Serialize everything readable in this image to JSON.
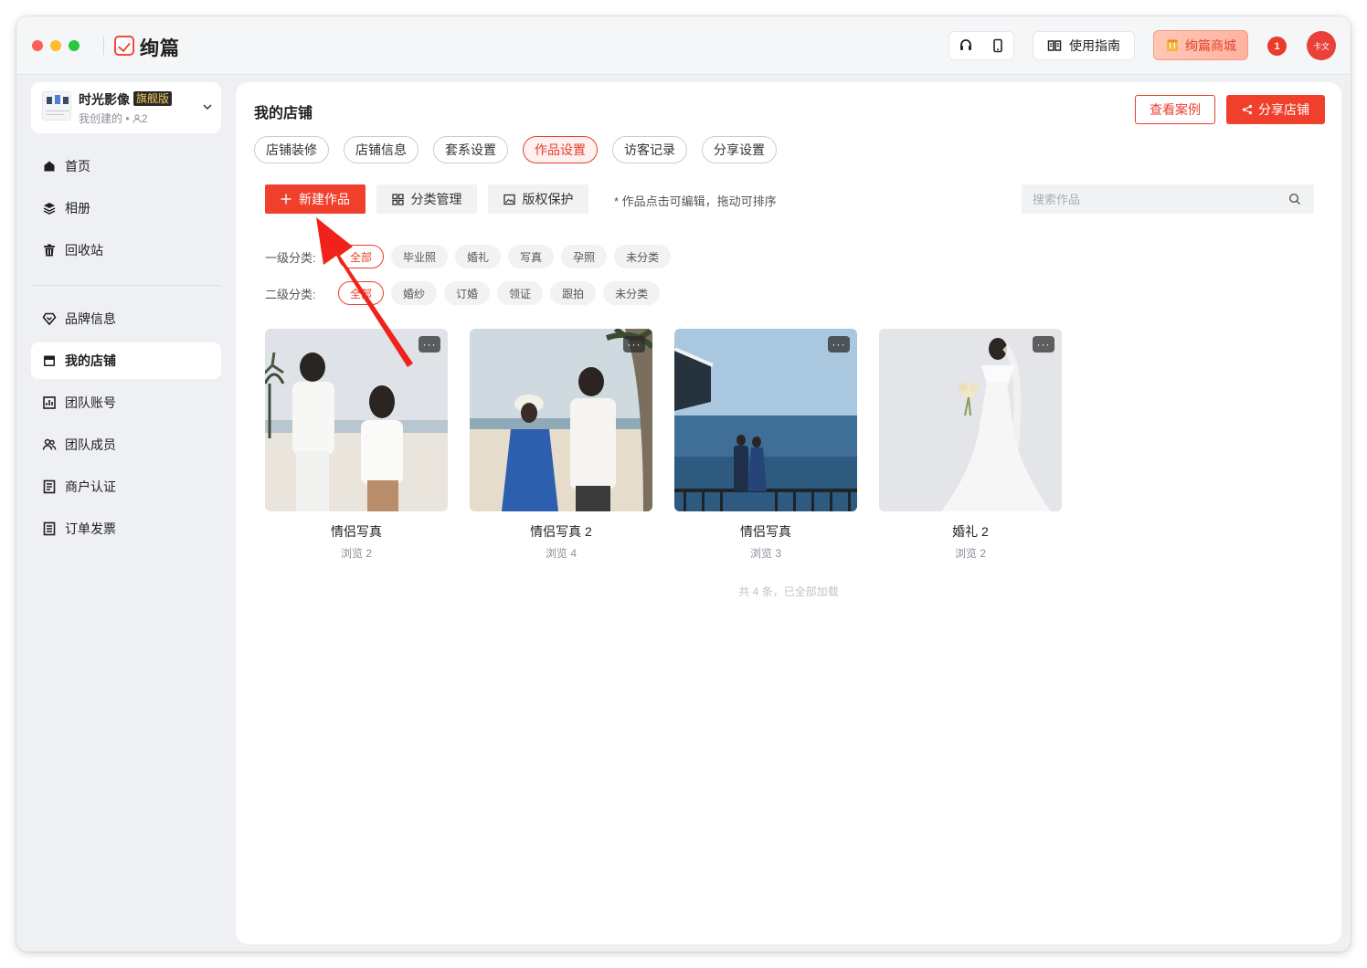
{
  "app": {
    "name": "绚篇"
  },
  "titlebar": {
    "guide_label": "使用指南",
    "mall_label": "绚篇商城",
    "badge_text": "1",
    "avatar_text": "卡文"
  },
  "store": {
    "name": "时光影像",
    "tag": "旗舰版",
    "meta": "我创建的 • ",
    "member_count": "2"
  },
  "sidebar": {
    "items": [
      {
        "label": "首页",
        "icon": "home-icon"
      },
      {
        "label": "相册",
        "icon": "layers-icon"
      },
      {
        "label": "回收站",
        "icon": "trash-icon"
      },
      {
        "label": "品牌信息",
        "icon": "brand-icon"
      },
      {
        "label": "我的店铺",
        "icon": "store-icon",
        "active": true
      },
      {
        "label": "团队账号",
        "icon": "chart-icon"
      },
      {
        "label": "团队成员",
        "icon": "members-icon"
      },
      {
        "label": "商户认证",
        "icon": "doc-icon"
      },
      {
        "label": "订单发票",
        "icon": "invoice-icon"
      }
    ]
  },
  "main": {
    "title": "我的店铺",
    "view_cases": "查看案例",
    "share_store": "分享店铺",
    "tabs": [
      "店铺装修",
      "店铺信息",
      "套系设置",
      "作品设置",
      "访客记录",
      "分享设置"
    ],
    "active_tab": "作品设置",
    "new_work": "新建作品",
    "category_manage": "分类管理",
    "copyright": "版权保护",
    "hint": "* 作品点击可编辑，拖动可排序",
    "search_placeholder": "搜索作品",
    "filter1_label": "一级分类:",
    "filter1": [
      "全部",
      "毕业照",
      "婚礼",
      "写真",
      "孕照",
      "未分类"
    ],
    "filter2_label": "二级分类:",
    "filter2": [
      "全部",
      "婚纱",
      "订婚",
      "领证",
      "跟拍",
      "未分类"
    ],
    "works": [
      {
        "title": "情侣写真",
        "views": "浏览 2"
      },
      {
        "title": "情侣写真 2",
        "views": "浏览 4"
      },
      {
        "title": "情侣写真",
        "views": "浏览 3"
      },
      {
        "title": "婚礼 2",
        "views": "浏览 2"
      }
    ],
    "more_label": "···",
    "footer": "共 4 条，已全部加载"
  },
  "colors": {
    "accent": "#f0402c",
    "accent_text": "#e8402e",
    "sidebar_bg": "#eef0f3"
  }
}
